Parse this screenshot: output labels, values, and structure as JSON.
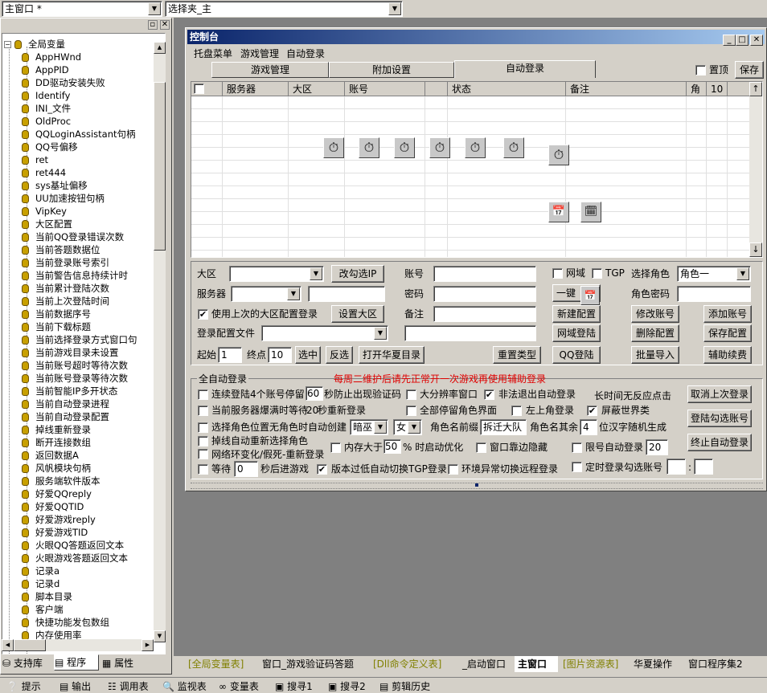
{
  "top": {
    "window_combo": "主窗口 *",
    "folder_combo": "选择夹_主"
  },
  "tree": {
    "root": "全局变量",
    "items": [
      "AppHWnd",
      "AppPID",
      "DD驱动安装失败",
      "Identify",
      "INI_文件",
      "OldProc",
      "QQLoginAssistant句柄",
      "QQ号偏移",
      "ret",
      "ret444",
      "sys基址偏移",
      "UU加速按钮句柄",
      "VipKey",
      "大区配置",
      "当前QQ登录错误次数",
      "当前答题数据位",
      "当前登录账号索引",
      "当前警告信息持续计时",
      "当前累计登陆次数",
      "当前上次登陆时间",
      "当前数据序号",
      "当前下载标题",
      "当前选择登录方式窗口句",
      "当前游戏目录未设置",
      "当前账号超时等待次数",
      "当前账号登录等待次数",
      "当前智能IP多开状态",
      "当前自动登录进程",
      "当前自动登录配置",
      "掉线重新登录",
      "断开连接数组",
      "返回数据A",
      "风帆模块句柄",
      "服务端软件版本",
      "好爱QQreply",
      "好爱QQTID",
      "好爱游戏reply",
      "好爱游戏TID",
      "火眼QQ答题返回文本",
      "火眼游戏答题返回文本",
      "记录a",
      "记录d",
      "脚本目录",
      "客户端",
      "快捷功能发包数组",
      "内存使用率"
    ]
  },
  "left_tabs": [
    "支持库",
    "程序",
    "属性"
  ],
  "console": {
    "title": "控制台",
    "menu": [
      "托盘菜单",
      "游戏管理",
      "自动登录"
    ],
    "tabs": [
      "游戏管理",
      "附加设置",
      "自动登录"
    ],
    "pin_label": "置顶",
    "save_label": "保存"
  },
  "grid": {
    "columns": [
      "服务器",
      "大区",
      "账号",
      "状态",
      "备注",
      "角",
      "10"
    ]
  },
  "form": {
    "area_label": "大区",
    "change_ip": "改勾选IP",
    "account_label": "账号",
    "netdomain_label": "网域",
    "tgp_label": "TGP",
    "select_role_label": "选择角色",
    "role_value": "角色一",
    "server_label": "服务器",
    "password_label": "密码",
    "one_key": "一键",
    "role_pwd_label": "角色密码",
    "use_last": "使用上次的大区配置登录",
    "set_area": "设置大区",
    "remark_label": "备注",
    "new_config": "新建配置",
    "modify_account": "修改账号",
    "add_account": "添加账号",
    "login_config_label": "登录配置文件",
    "netdomain_login": "网域登陆",
    "delete_config": "删除配置",
    "save_config": "保存配置",
    "start_label": "起始",
    "start_value": "1",
    "end_label": "终点",
    "end_value": "10",
    "select": "选中",
    "invert": "反选",
    "open_dir": "打开华夏目录",
    "reset_type": "重置类型",
    "qq_login": "QQ登陆",
    "batch_import": "批量导入",
    "renew": "辅助续费"
  },
  "auto": {
    "title": "全自动登录",
    "notice": "每周二维护后请先正常开一次游戏再使用辅助登录",
    "opt1_a": "连续登陆4个账号停留",
    "opt1_val": "60",
    "opt1_b": "秒防止出现验证码",
    "big_res": "大分辨率窗口",
    "illegal_exit": "非法退出自动登录",
    "long_no_resp": "长时间无反应点击",
    "cancel_last": "取消上次登录",
    "opt2": "当前服务器爆满时等待",
    "opt2_val": "20",
    "opt2_b": "秒重新登录",
    "all_stay": "全部停留角色界面",
    "top_left": "左上角登录",
    "block_world": "屏蔽世界类",
    "login_checked": "登陆勾选账号",
    "opt3": "选择角色位置无角色时自动创建",
    "class_val": "暗巫",
    "gender_val": "女",
    "prefix_label": "角色名前缀",
    "prefix_val": "拆迁大队",
    "rest_label": "角色名其余",
    "rest_val": "4",
    "rest_b": "位汉字随机生成",
    "stop_auto": "终止自动登录",
    "opt4": "掉线自动重新选择角色",
    "mem_label": "内存大于",
    "mem_val": "50",
    "mem_b": "% 时启动优化",
    "window_hide": "窗口靠边隐藏",
    "limit_login": "限号自动登录",
    "limit_val": "20",
    "opt5": "网络环变化/假死-重新登录",
    "wait_label": "等待",
    "wait_val": "0",
    "wait_b": "秒后进游戏",
    "version_tgp": "版本过低自动切换TGP登录",
    "env_remote": "环境异常切换远程登录",
    "timed_login": "定时登录勾选账号"
  },
  "bottom_tabs": [
    "[全局变量表]",
    "窗口_游戏验证码答题",
    "[Dll命令定义表]",
    "_启动窗口",
    "主窗口",
    "[图片资源表]",
    "华夏操作",
    "窗口程序集2"
  ],
  "status_tabs": [
    "提示",
    "输出",
    "调用表",
    "监视表",
    "变量表",
    "搜寻1",
    "搜寻2",
    "剪辑历史"
  ]
}
